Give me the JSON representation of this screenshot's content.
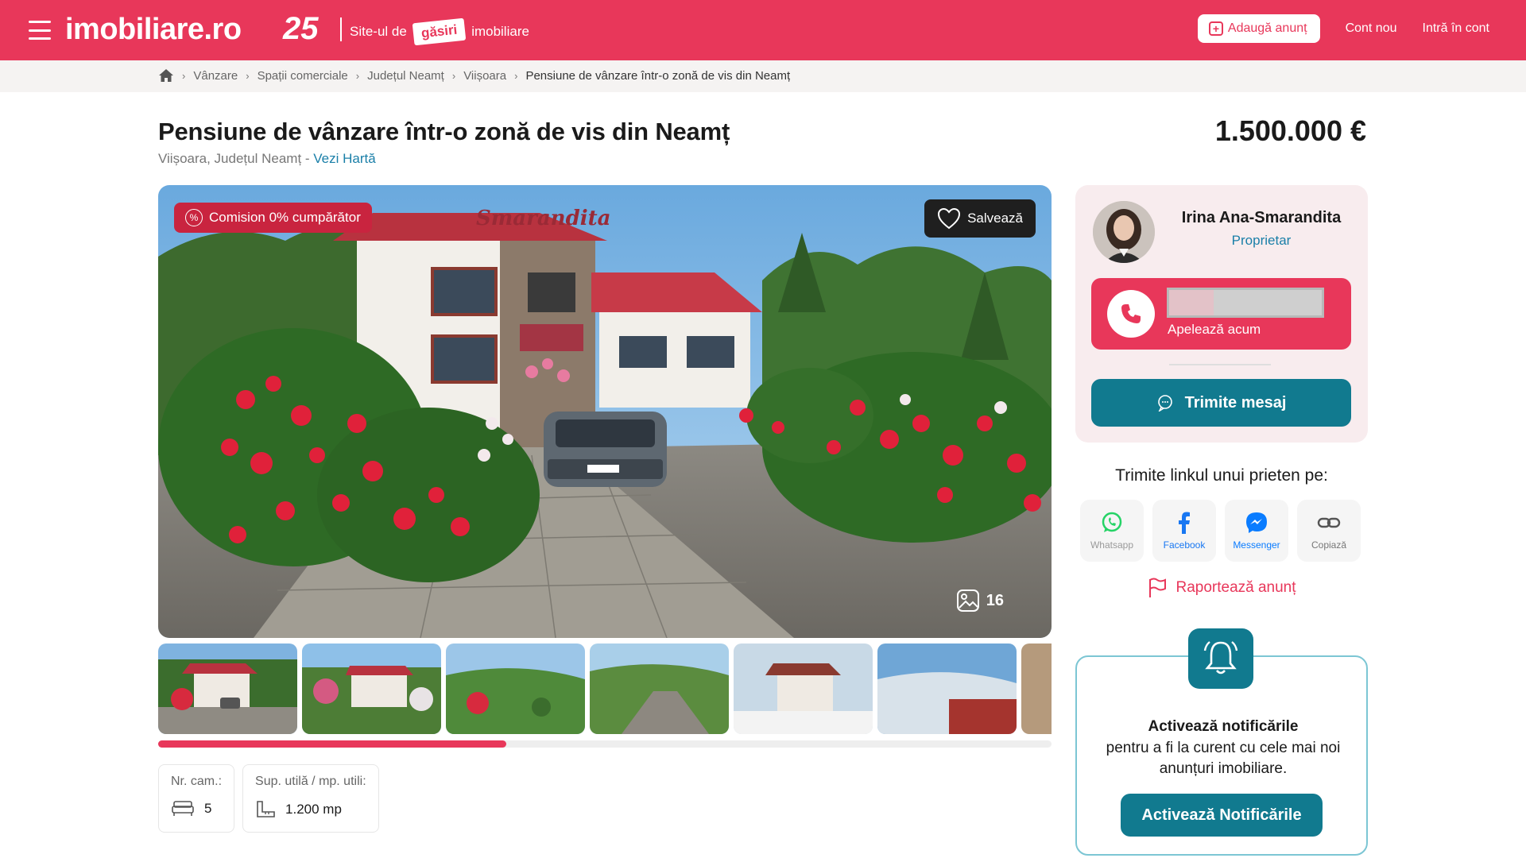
{
  "header": {
    "logo": "imobiliare.ro",
    "anniversary": "25",
    "tagline_prefix": "Site-ul de",
    "tagline_highlight": "găsiri",
    "tagline_suffix": "imobiliare",
    "add_listing_label": "Adaugă anunț",
    "new_account_label": "Cont nou",
    "login_label": "Intră în cont",
    "brand_color": "#e8375a"
  },
  "breadcrumb": {
    "items": [
      "Vânzare",
      "Spații comerciale",
      "Județul Neamț",
      "Viișoara"
    ],
    "current": "Pensiune de vânzare într-o zonă de vis din Neamț"
  },
  "listing": {
    "title": "Pensiune de vânzare într-o zonă de vis din Neamț",
    "location": "Viișoara, Județul Neamț",
    "location_sep": " - ",
    "map_link": "Vezi Hartă",
    "price": "1.500.000 €",
    "commission_badge": "Comision 0% cumpărător",
    "save_label": "Salvează",
    "photo_count": "16",
    "gallery_scroll_fraction": 0.39
  },
  "specs": [
    {
      "label": "Nr. cam.:",
      "value": "5",
      "icon": "bed-icon"
    },
    {
      "label": "Sup. utilă / mp. utili:",
      "value": "1.200 mp",
      "icon": "area-icon"
    }
  ],
  "agent": {
    "name": "Irina Ana-Smarandita",
    "role": "Proprietar",
    "call_label": "Apelează acum",
    "message_label": "Trimite mesaj",
    "accent": "#117a8f"
  },
  "share": {
    "title": "Trimite linkul unui prieten pe:",
    "buttons": [
      {
        "label": "Whatsapp",
        "icon": "whatsapp-icon",
        "color": "#25d366"
      },
      {
        "label": "Facebook",
        "icon": "facebook-icon",
        "color": "#1877f2"
      },
      {
        "label": "Messenger",
        "icon": "messenger-icon",
        "color": "#0a7cff"
      },
      {
        "label": "Copiază",
        "icon": "link-icon",
        "color": "#555555"
      }
    ],
    "report_label": "Raportează anunț"
  },
  "notifications": {
    "title": "Activează notificările",
    "body": "pentru a fi la curent cu cele mai noi anunțuri imobiliare.",
    "button_label": "Activează Notificările"
  }
}
